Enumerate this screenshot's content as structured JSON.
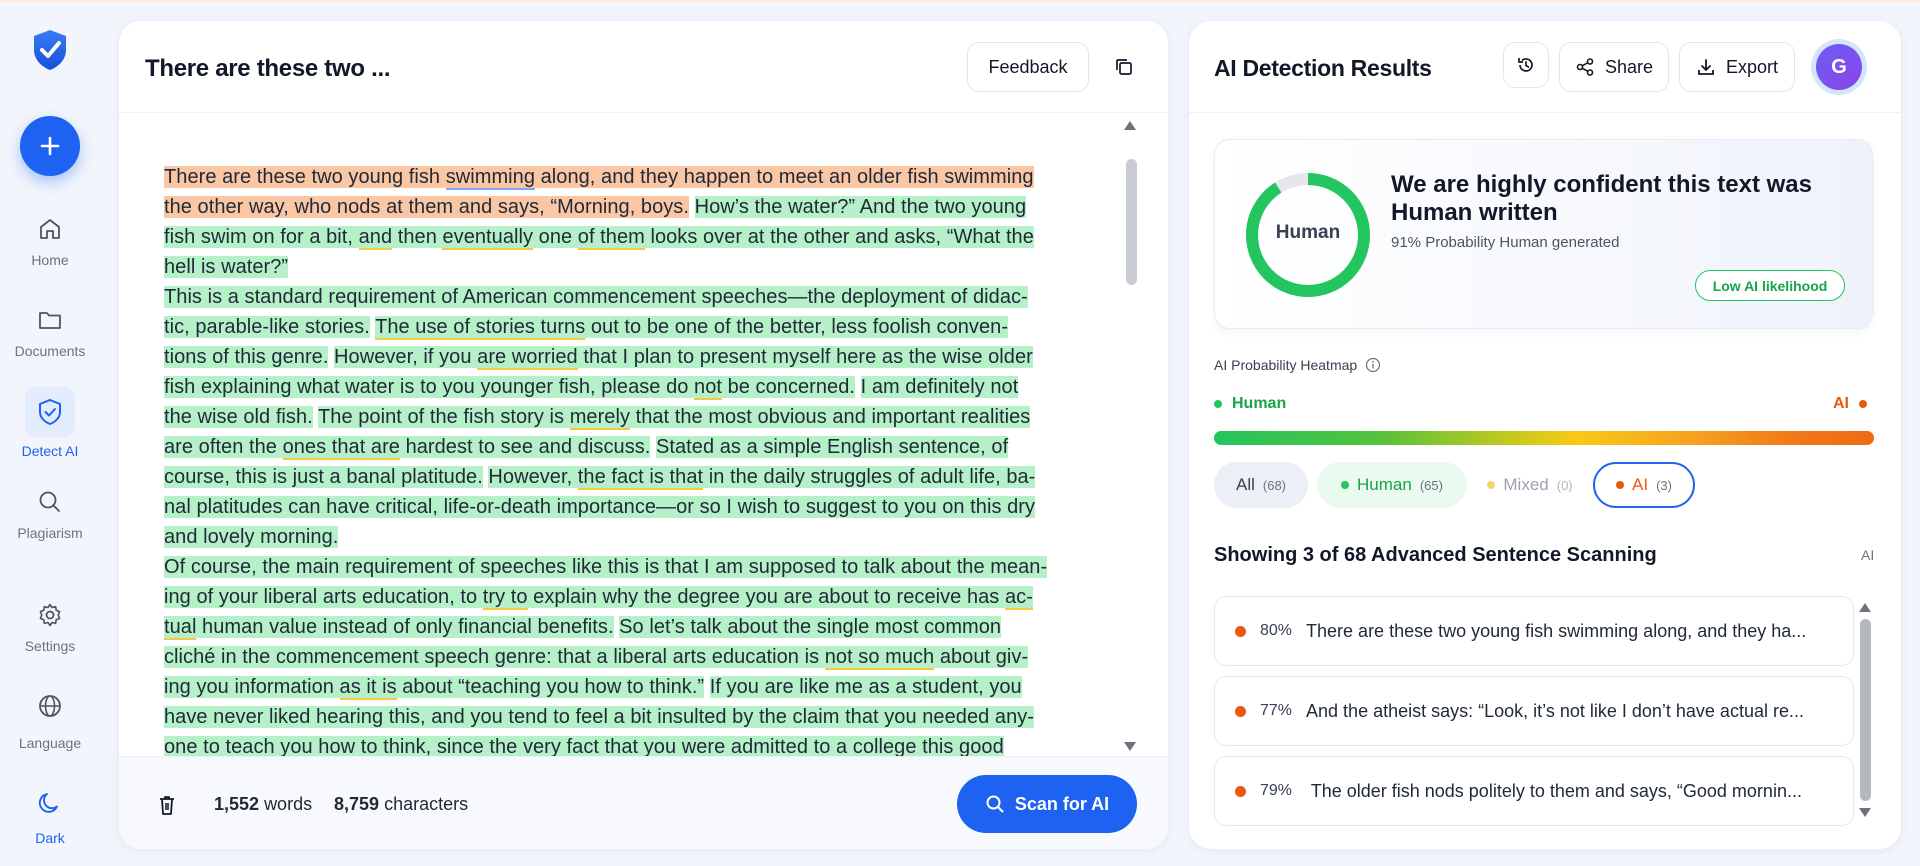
{
  "sidebar": {
    "items": [
      {
        "label": "Home",
        "icon": "home-icon"
      },
      {
        "label": "Documents",
        "icon": "folder-icon"
      },
      {
        "label": "Detect AI",
        "icon": "shield-check-icon"
      },
      {
        "label": "Plagiarism",
        "icon": "search-icon"
      },
      {
        "label": "Settings",
        "icon": "gear-icon"
      },
      {
        "label": "Language",
        "icon": "globe-icon"
      },
      {
        "label": "Dark",
        "icon": "moon-icon"
      }
    ]
  },
  "editor": {
    "title": "There are these two ...",
    "feedback_label": "Feedback",
    "paragraphs": [
      [
        {
          "t": "There are these two young fish swimming along, and they happen to meet an older fish swimming the other way, who nods at them and says, “Morning, boys.",
          "c": "hl-ai"
        },
        {
          "t": " ",
          "c": ""
        },
        {
          "t": "How’s the water?” And the two young fish swim on for a bit, and then eventually one of them looks over at the other and asks, “What the hell is water?”",
          "c": "hl-h"
        }
      ],
      [
        {
          "t": "This is a standard requirement of American commencement speeches—the deployment of didac­tic, parable-like stories.",
          "c": "hl-h"
        },
        {
          "t": " ",
          "c": ""
        },
        {
          "t": "The use of stories turns out to be one of the better, less foolish conven­tions of this genre.",
          "c": "hl-h"
        },
        {
          "t": " ",
          "c": ""
        },
        {
          "t": "However, if you are worried that I plan to present myself here as the wise older fish explaining what water is to you younger fish, please do not be concerned.",
          "c": "hl-h"
        },
        {
          "t": " ",
          "c": ""
        },
        {
          "t": "I am definitely not the wise old fish.",
          "c": "hl-h"
        },
        {
          "t": " ",
          "c": ""
        },
        {
          "t": "The point of the fish story is merely that the most obvious and important realities are often the ones that are hardest to see and discuss.",
          "c": "hl-h"
        },
        {
          "t": " ",
          "c": ""
        },
        {
          "t": "Stated as a simple English sentence, of course, this is just a banal platitude.",
          "c": "hl-h"
        },
        {
          "t": " ",
          "c": ""
        },
        {
          "t": "However, the fact is that in the daily struggles of adult life, ba­nal platitudes can have critical, life-or-death importance—or so I wish to suggest to you on this dry and lovely morning.",
          "c": "hl-h"
        }
      ],
      [
        {
          "t": "Of course, the main requirement of speeches like this is that I am supposed to talk about the mean­ing of your liberal arts education, to try to explain why the degree you are about to receive has ac­tual human value instead of only financial benefits.",
          "c": "hl-h"
        },
        {
          "t": " ",
          "c": ""
        },
        {
          "t": "So let’s talk about the single most common cliché in the commencement speech genre: that a liberal arts education is not so much about giv­ing you information as it is about “teaching you how to think.”",
          "c": "hl-h"
        },
        {
          "t": " ",
          "c": ""
        },
        {
          "t": "If you are like me as a student, you have never liked hearing this, and you tend to feel a bit insulted by the claim that you needed any­one to teach you how to think, since the very fact that you were admitted to a college this good",
          "c": "hl-h"
        }
      ]
    ],
    "word_count": "1,552",
    "words_label": "words",
    "char_count": "8,759",
    "chars_label": "characters",
    "scan_label": "Scan for AI"
  },
  "results": {
    "title": "AI Detection Results",
    "share_label": "Share",
    "export_label": "Export",
    "avatar_initial": "G",
    "summary": {
      "donut_label": "Human",
      "human_probability": 0.91,
      "headline": "We are highly confident this text was Human written",
      "sub": "91% Probability Human generated",
      "badge": "Low AI likelihood"
    },
    "heatmap": {
      "label": "AI Probability Heatmap",
      "left_label": "Human",
      "right_label": "AI"
    },
    "filters": [
      {
        "label": "All",
        "count": "(68)"
      },
      {
        "label": "Human",
        "count": "(65)"
      },
      {
        "label": "Mixed",
        "count": "(0)"
      },
      {
        "label": "AI",
        "count": "(3)"
      }
    ],
    "showing_title": "Showing 3 of 68 Advanced Sentence Scanning",
    "showing_tag": "AI",
    "sentences": [
      {
        "pct": "80%",
        "text": "There are these two young fish swimming along, and they ha..."
      },
      {
        "pct": "77%",
        "text": "And the atheist says: “Look, it’s not like I don’t have actual re..."
      },
      {
        "pct": "79%",
        "text": " The older fish nods politely to them and says, “Good mornin..."
      }
    ]
  },
  "colors": {
    "accent": "#1d62f0",
    "human": "#22c55e",
    "ai": "#ea580c",
    "mixed": "#f5d36b"
  }
}
